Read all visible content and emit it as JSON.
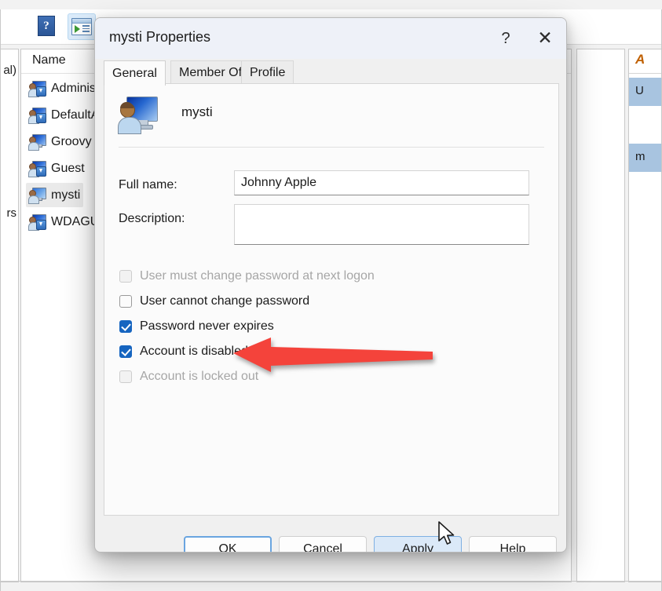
{
  "background": {
    "toolbar": {
      "buttons": [
        {
          "name": "help-icon",
          "label": "?"
        },
        {
          "name": "window-play-icon",
          "label": ""
        }
      ]
    },
    "tree_panel": {
      "fragments": [
        "al)",
        "rs"
      ]
    },
    "list_panel": {
      "column_header": "Name",
      "rows": [
        {
          "name": "Administrator",
          "label": "Adminis",
          "disabled": true,
          "selected": false
        },
        {
          "name": "DefaultAccount",
          "label": "DefaultA",
          "disabled": true,
          "selected": false
        },
        {
          "name": "Groovy",
          "label": "Groovy",
          "disabled": false,
          "selected": false
        },
        {
          "name": "Guest",
          "label": "Guest",
          "disabled": true,
          "selected": false
        },
        {
          "name": "mysti",
          "label": "mysti",
          "disabled": false,
          "selected": true
        },
        {
          "name": "WDAGUtilityAccount",
          "label": "WDAGU",
          "disabled": true,
          "selected": false
        }
      ]
    },
    "right_panel": {
      "header": "A",
      "rows": [
        "U",
        "m"
      ]
    }
  },
  "dialog": {
    "title": "mysti Properties",
    "system_buttons": {
      "help": "?",
      "close": "✕"
    },
    "tabs": [
      {
        "label": "General",
        "active": true
      },
      {
        "label": "Member Of",
        "active": false
      },
      {
        "label": "Profile",
        "active": false
      }
    ],
    "account": {
      "icon": "user-account-icon",
      "username": "mysti"
    },
    "fields": [
      {
        "label": "Full name:",
        "value": "Johnny Apple",
        "placeholder": ""
      },
      {
        "label": "Description:",
        "value": "",
        "placeholder": ""
      }
    ],
    "checkboxes": [
      {
        "label": "User must change password at next logon",
        "checked": false,
        "disabled": true
      },
      {
        "label": "User cannot change password",
        "checked": false,
        "disabled": false
      },
      {
        "label": "Password never expires",
        "checked": true,
        "disabled": false
      },
      {
        "label": "Account is disabled",
        "checked": true,
        "disabled": false
      },
      {
        "label": "Account is locked out",
        "checked": false,
        "disabled": true
      }
    ],
    "buttons": [
      {
        "label": "OK",
        "state": "focused"
      },
      {
        "label": "Cancel",
        "state": "normal"
      },
      {
        "label": "Apply",
        "state": "hover"
      },
      {
        "label": "Help",
        "state": "normal"
      }
    ]
  },
  "annotation": {
    "arrow": {
      "color": "#F44336",
      "direction": "left",
      "points_at": "Account is disabled"
    }
  },
  "colors": {
    "checkbox_checked": "#1665C0",
    "button_hover": "#DBE9F8",
    "button_focus_border": "#6AA5E0",
    "titlebar": "#EEF1F8",
    "annotation_red": "#F44336",
    "row_selected": "#EAEAEA",
    "right_row_highlight": "#A8C4E0"
  }
}
